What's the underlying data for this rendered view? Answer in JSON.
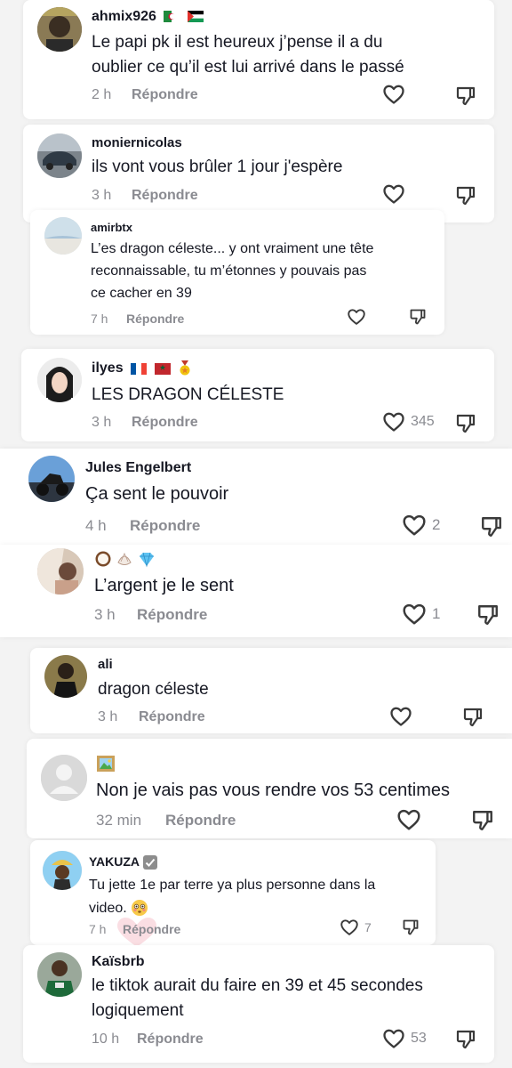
{
  "comments": [
    {
      "username": "ahmix926",
      "text_lines": [
        "Le papi pk il est heureux j’pense il a du",
        "oublier ce qu’il est lui arrivé dans le passé"
      ],
      "time": "2 h",
      "reply": "Répondre",
      "likes": ""
    },
    {
      "username": "moniernicolas",
      "text_lines": [
        "ils vont vous brûler 1 jour j'espère"
      ],
      "time": "3 h",
      "reply": "Répondre",
      "likes": ""
    },
    {
      "username": "amirbtx",
      "text_lines": [
        "L’es dragon céleste... y ont vraiment une tête",
        "reconnaissable, tu m’étonnes y pouvais pas",
        "ce cacher en 39"
      ],
      "time": "7 h",
      "reply": "Répondre",
      "likes": ""
    },
    {
      "username": "ilyes",
      "text_lines": [
        "LES DRAGON CÉLESTE"
      ],
      "time": "3 h",
      "reply": "Répondre",
      "likes": "345"
    },
    {
      "username": "Jules Engelbert",
      "text_lines": [
        "Ça sent le pouvoir"
      ],
      "time": "4 h",
      "reply": "Répondre",
      "likes": "2"
    },
    {
      "username": "",
      "text_lines": [
        "L’argent je le sent"
      ],
      "time": "3 h",
      "reply": "Répondre",
      "likes": "1"
    },
    {
      "username": "ali",
      "text_lines": [
        "dragon céleste"
      ],
      "time": "3 h",
      "reply": "Répondre",
      "likes": ""
    },
    {
      "username": "",
      "text_lines": [
        "Non je vais pas vous rendre vos 53 centimes"
      ],
      "time": "32 min",
      "reply": "Répondre",
      "likes": ""
    },
    {
      "username": "YAKUZA",
      "text_lines": [
        "Tu jette 1e par terre ya plus personne dans la",
        "video."
      ],
      "time": "7 h",
      "reply": "Répondre",
      "likes": "7"
    },
    {
      "username": "Kaïsbrb",
      "text_lines": [
        "le tiktok aurait du faire en 39 et 45 secondes",
        "logiquement"
      ],
      "time": "10 h",
      "reply": "Répondre",
      "likes": "53"
    }
  ],
  "icons": {
    "like": "heart-outline-icon",
    "dislike": "thumbs-down-outline-icon",
    "verified": "verified-check-icon"
  },
  "colors": {
    "background": "#f3f3f3",
    "card": "#ffffff",
    "meta_text": "#8a8b91",
    "primary_text": "#161823"
  }
}
